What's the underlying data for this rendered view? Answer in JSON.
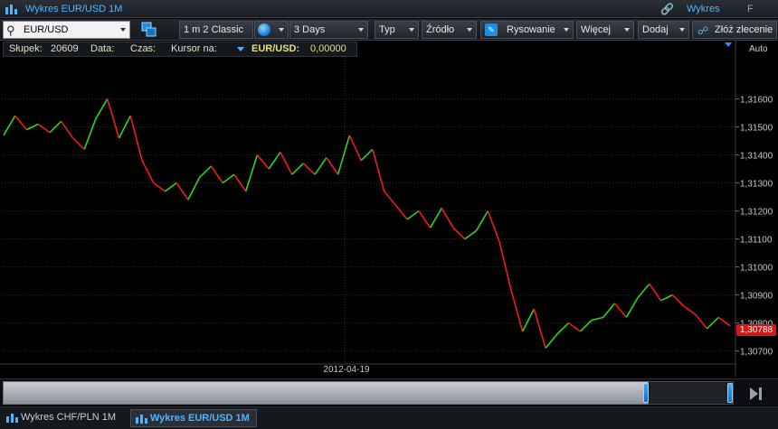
{
  "window": {
    "title": "Wykres EUR/USD 1M",
    "right_label": "Wykres",
    "right_letter": "F"
  },
  "toolbar": {
    "symbol": "EUR/USD",
    "interval": "1 m 2 Classic",
    "range": "3 Days",
    "typ": "Typ",
    "zrodlo": "Źródło",
    "rysowanie": "Rysowanie",
    "wiecej": "Więcej",
    "dodaj": "Dodaj",
    "zloz": "Złóż zlecenie"
  },
  "infobar": {
    "slupek_label": "Słupek:",
    "slupek_value": "20609",
    "data_label": "Data:",
    "czas_label": "Czas:",
    "kursor_label": "Kursor na:",
    "symbol": "EUR/USD:",
    "value": "0,00000"
  },
  "chart_data": {
    "type": "line",
    "style": "renko (green up / red down bricks)",
    "y_ticks": [
      "1,31600",
      "1,31500",
      "1,31400",
      "1,31300",
      "1,31200",
      "1,31100",
      "1,31000",
      "1,30900",
      "1,30800",
      "1,30700"
    ],
    "y_tick_values": [
      1.316,
      1.315,
      1.314,
      1.313,
      1.312,
      1.311,
      1.31,
      1.309,
      1.308,
      1.307
    ],
    "ylim": [
      1.3066,
      1.3175
    ],
    "x_label_date": "2012-04-19",
    "scale_mode": "Auto",
    "last_price": "1,30788",
    "colors": {
      "up": "#2bd61e",
      "down": "#ee1c1c",
      "grid": "#2a2e35",
      "axis_text": "#c8c8c8",
      "last_price_bg": "#d01919"
    },
    "series": [
      {
        "values": [
          1.3147,
          1.3154,
          1.3149,
          1.3151,
          1.3148,
          1.3152,
          1.3146,
          1.3142,
          1.3153,
          1.316,
          1.3146,
          1.3154,
          1.3138,
          1.313,
          1.3127,
          1.313,
          1.3124,
          1.3132,
          1.3136,
          1.313,
          1.3133,
          1.3127,
          1.314,
          1.3135,
          1.3141,
          1.3133,
          1.3137,
          1.3133,
          1.3139,
          1.3133,
          1.3147,
          1.3138,
          1.3142,
          1.3127,
          1.3122,
          1.3117,
          1.312,
          1.3114,
          1.3121,
          1.3114,
          1.311,
          1.3113,
          1.312,
          1.3109,
          1.3092,
          1.3077,
          1.3085,
          1.3071,
          1.3076,
          1.308,
          1.3077,
          1.3081,
          1.3082,
          1.3087,
          1.3082,
          1.3089,
          1.3094,
          1.3088,
          1.309,
          1.3086,
          1.3083,
          1.3078,
          1.3082,
          1.3079
        ]
      }
    ]
  },
  "bottombar": {
    "tab1": "Wykres CHF/PLN 1M",
    "tab2": "Wykres EUR/USD 1M"
  }
}
